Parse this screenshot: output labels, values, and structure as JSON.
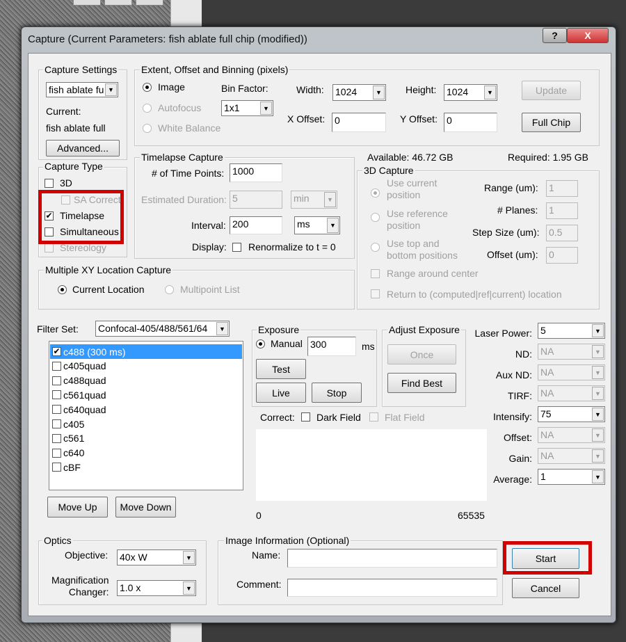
{
  "window": {
    "title": "Capture (Current Parameters: fish ablate full chip (modified))",
    "help": "?",
    "close": "X"
  },
  "capture_settings": {
    "legend": "Capture Settings",
    "preset": "fish ablate fu",
    "current_label": "Current:",
    "current_value": "fish ablate full",
    "advanced": "Advanced..."
  },
  "capture_type": {
    "legend": "Capture Type",
    "items": [
      {
        "label": "3D",
        "checked": false
      },
      {
        "label": "SA Correct",
        "checked": false
      },
      {
        "label": "Timelapse",
        "checked": true
      },
      {
        "label": "Simultaneous",
        "checked": false
      },
      {
        "label": "Stereology",
        "checked": false
      }
    ]
  },
  "extent": {
    "legend": "Extent, Offset and Binning (pixels)",
    "modes": [
      "Image",
      "Autofocus",
      "White Balance"
    ],
    "bin_label": "Bin Factor:",
    "bin": "1x1",
    "width_label": "Width:",
    "width": "1024",
    "height_label": "Height:",
    "height": "1024",
    "update": "Update",
    "xoff_label": "X Offset:",
    "xoff": "0",
    "yoff_label": "Y Offset:",
    "yoff": "0",
    "full_chip": "Full Chip"
  },
  "timelapse": {
    "legend": "Timelapse Capture",
    "points_label": "# of Time Points:",
    "points": "1000",
    "est_label": "Estimated Duration:",
    "est": "5",
    "est_unit": "min",
    "interval_label": "Interval:",
    "interval": "200",
    "interval_unit": "ms",
    "display_label": "Display:",
    "renorm": "Renormalize to t = 0"
  },
  "storage": {
    "available": "Available: 46.72 GB",
    "required": "Required: 1.95 GB"
  },
  "capture3d": {
    "legend": "3D Capture",
    "opt1a": "Use current",
    "opt1b": "position",
    "opt2a": "Use reference",
    "opt2b": "position",
    "opt3a": "Use top and",
    "opt3b": "bottom positions",
    "range_label": "Range (um):",
    "range": "1",
    "planes_label": "# Planes:",
    "planes": "1",
    "step_label": "Step Size (um):",
    "step": "0.5",
    "offset_label": "Offset (um):",
    "offset": "0",
    "range_center": "Range around center",
    "return_loc": "Return to (computed|ref|current) location"
  },
  "xy": {
    "legend": "Multiple XY Location Capture",
    "current": "Current Location",
    "multipoint": "Multipoint List"
  },
  "filter": {
    "label": "Filter Set:",
    "value": "Confocal-405/488/561/64",
    "items": [
      "c488 (300 ms)",
      "c405quad",
      "c488quad",
      "c561quad",
      "c640quad",
      "c405",
      "c561",
      "c640",
      "cBF"
    ],
    "move_up": "Move Up",
    "move_down": "Move Down"
  },
  "exposure": {
    "legend": "Exposure",
    "manual": "Manual",
    "value": "300",
    "unit": "ms",
    "test": "Test",
    "live": "Live",
    "stop": "Stop"
  },
  "adjust": {
    "legend": "Adjust Exposure",
    "once": "Once",
    "find_best": "Find Best"
  },
  "correct": {
    "label": "Correct:",
    "dark": "Dark Field",
    "flat": "Flat Field"
  },
  "histogram": {
    "min": "0",
    "max": "65535"
  },
  "laser": [
    {
      "label": "Laser Power:",
      "value": "5",
      "enabled": true
    },
    {
      "label": "ND:",
      "value": "NA",
      "enabled": false
    },
    {
      "label": "Aux ND:",
      "value": "NA",
      "enabled": false
    },
    {
      "label": "TIRF:",
      "value": "NA",
      "enabled": false
    },
    {
      "label": "Intensify:",
      "value": "75",
      "enabled": true
    },
    {
      "label": "Offset:",
      "value": "NA",
      "enabled": false
    },
    {
      "label": "Gain:",
      "value": "NA",
      "enabled": false
    },
    {
      "label": "Average:",
      "value": "1",
      "enabled": true
    }
  ],
  "optics": {
    "legend": "Optics",
    "objective_label": "Objective:",
    "objective": "40x W",
    "mag_label1": "Magnification",
    "mag_label2": "Changer:",
    "mag": "1.0 x"
  },
  "info": {
    "legend": "Image Information (Optional)",
    "name_label": "Name:",
    "comment_label": "Comment:"
  },
  "actions": {
    "start": "Start",
    "cancel": "Cancel"
  }
}
